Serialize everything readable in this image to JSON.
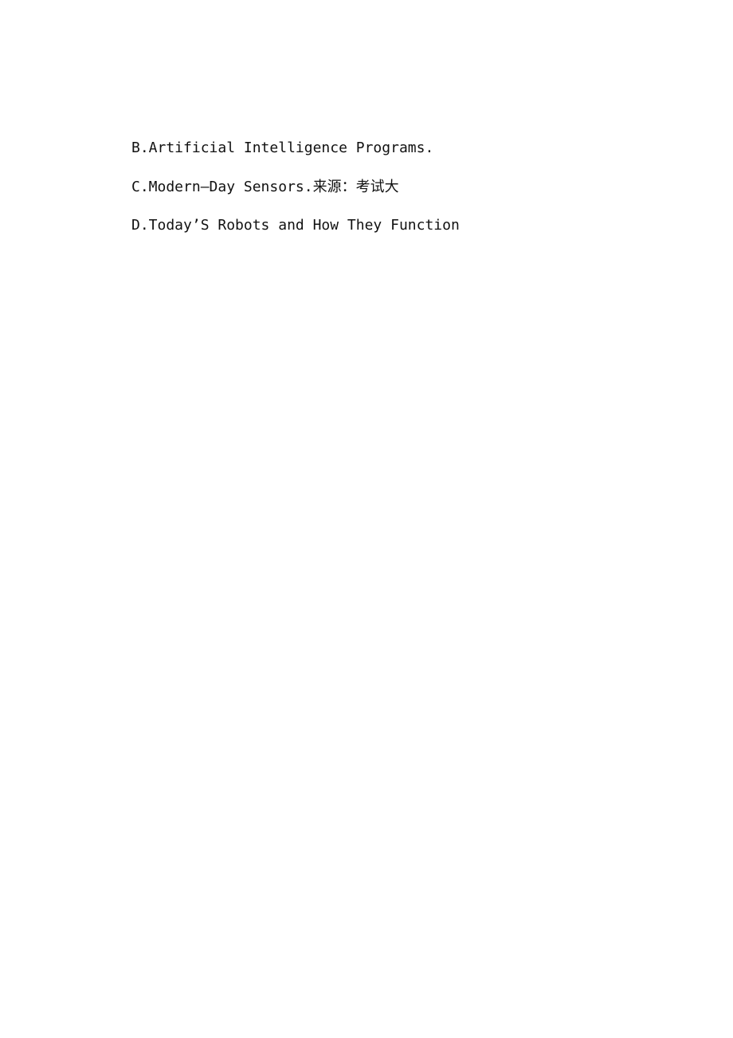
{
  "document": {
    "options": [
      {
        "text": "B.Artificial Intelligence Programs."
      },
      {
        "text": "C.Modern—Day Sensors.来源：考试大"
      },
      {
        "text": "D.Today’S Robots and How They Function"
      }
    ]
  }
}
